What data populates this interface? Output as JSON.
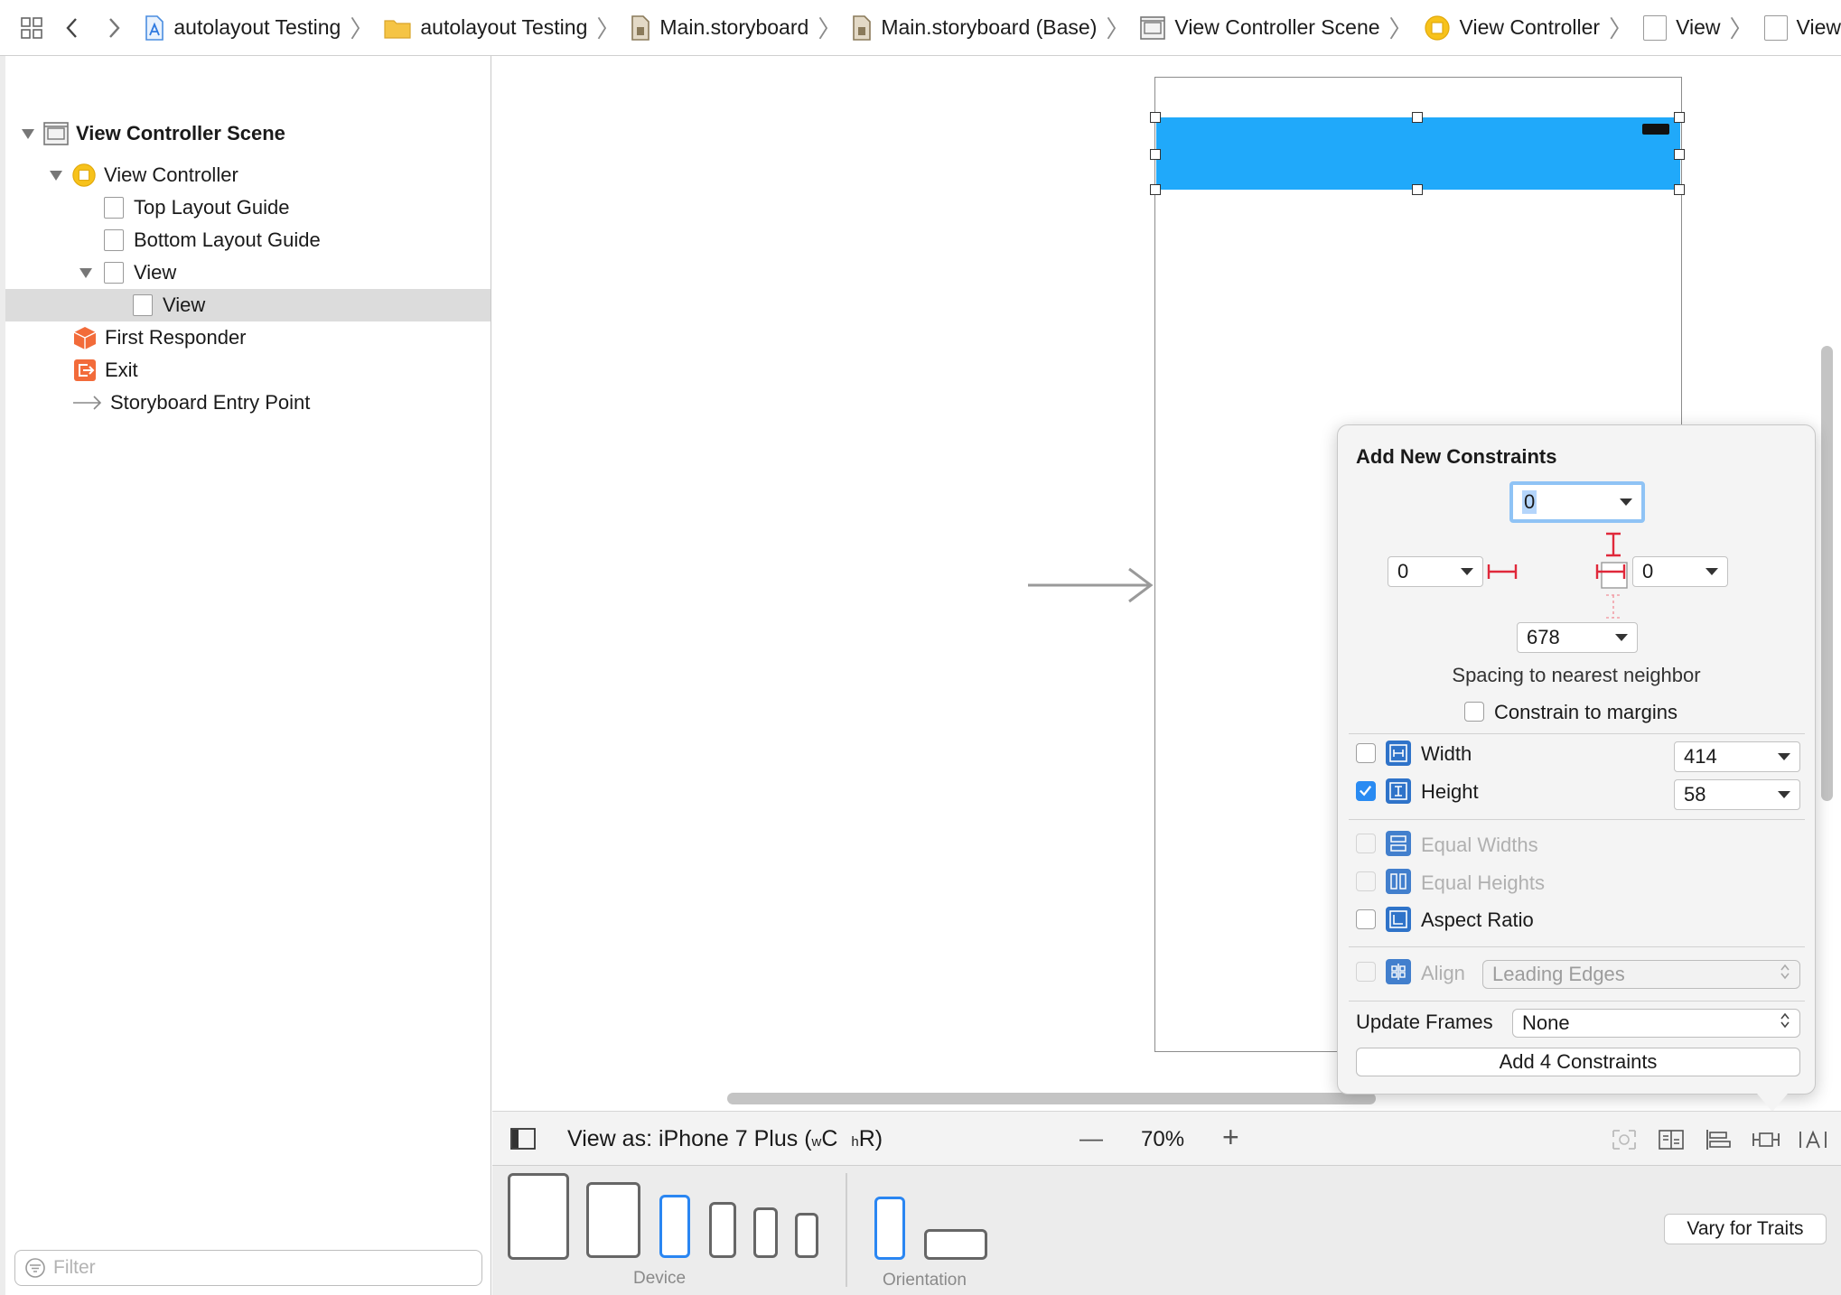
{
  "jumpbar": {
    "crumbs": [
      {
        "label": "autolayout Testing",
        "icon": "project-icon"
      },
      {
        "label": "autolayout Testing",
        "icon": "folder-icon"
      },
      {
        "label": "Main.storyboard",
        "icon": "storyboard-file-icon"
      },
      {
        "label": "Main.storyboard (Base)",
        "icon": "storyboard-file-icon"
      },
      {
        "label": "View Controller Scene",
        "icon": "scene-icon"
      },
      {
        "label": "View Controller",
        "icon": "view-controller-icon"
      },
      {
        "label": "View",
        "icon": "view-icon"
      },
      {
        "label": "View",
        "icon": "view-icon"
      }
    ]
  },
  "outline": {
    "items": [
      {
        "label": "View Controller Scene",
        "icon": "scene-icon"
      },
      {
        "label": "View Controller",
        "icon": "view-controller-icon"
      },
      {
        "label": "Top Layout Guide",
        "icon": "layout-guide-icon"
      },
      {
        "label": "Bottom Layout Guide",
        "icon": "layout-guide-icon"
      },
      {
        "label": "View",
        "icon": "view-icon"
      },
      {
        "label": "View",
        "icon": "view-icon",
        "selected": true
      },
      {
        "label": "First Responder",
        "icon": "first-responder-icon"
      },
      {
        "label": "Exit",
        "icon": "exit-icon"
      },
      {
        "label": "Storyboard Entry Point",
        "icon": "entry-arrow-icon"
      }
    ],
    "filter_placeholder": "Filter"
  },
  "popover": {
    "title": "Add New Constraints",
    "top": "0",
    "left": "0",
    "right": "0",
    "bottom": "678",
    "spacing_label": "Spacing to nearest neighbor",
    "constrain_margins": "Constrain to margins",
    "width_label": "Width",
    "width_value": "414",
    "height_label": "Height",
    "height_value": "58",
    "equal_widths": "Equal Widths",
    "equal_heights": "Equal Heights",
    "aspect_ratio": "Aspect Ratio",
    "align_label": "Align",
    "align_value": "Leading Edges",
    "update_frames_label": "Update Frames",
    "update_frames_value": "None",
    "add_button": "Add 4 Constraints",
    "checked": {
      "constrain_margins": false,
      "width": false,
      "height": true,
      "equal_widths": false,
      "equal_heights": false,
      "aspect_ratio": false,
      "align": false
    }
  },
  "statusbar": {
    "view_as": "View as: iPhone 7 Plus (",
    "w": "w",
    "C": "C",
    "h": "h",
    "R": "R",
    "close_paren": ")",
    "zoom_out": "—",
    "zoom": "70%",
    "zoom_in": "+"
  },
  "devicebar": {
    "device_label": "Device",
    "orientation_label": "Orientation",
    "vary_button": "Vary for Traits"
  },
  "colors": {
    "selected_view": "#20a9fa",
    "accent": "#2a86f2",
    "constraint_red": "#e0283a",
    "vc_yellow": "#f7c21b",
    "responder_orange": "#f26b3a"
  }
}
